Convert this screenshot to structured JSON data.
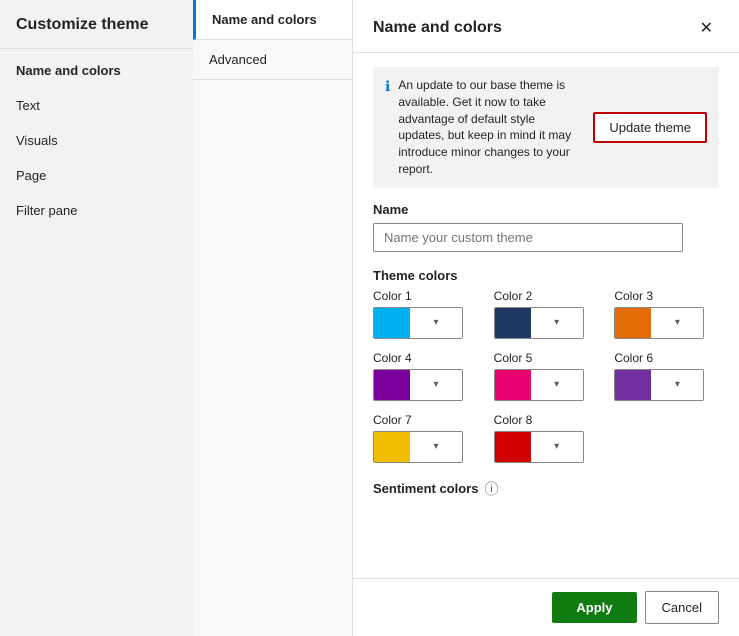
{
  "sidebar": {
    "title": "Customize theme",
    "items": [
      {
        "id": "name-and-colors",
        "label": "Name and colors",
        "active": true
      },
      {
        "id": "text",
        "label": "Text",
        "active": false
      },
      {
        "id": "visuals",
        "label": "Visuals",
        "active": false
      },
      {
        "id": "page",
        "label": "Page",
        "active": false
      },
      {
        "id": "filter-pane",
        "label": "Filter pane",
        "active": false
      }
    ]
  },
  "middle_tabs": [
    {
      "id": "name-and-colors",
      "label": "Name and colors",
      "active": true
    },
    {
      "id": "advanced",
      "label": "Advanced",
      "active": false
    }
  ],
  "main": {
    "title": "Name and colors",
    "close_label": "✕",
    "info_text": "An update to our base theme is available. Get it now to take advantage of default style updates, but keep in mind it may introduce minor changes to your report.",
    "update_theme_label": "Update theme",
    "name_section": {
      "label": "Name",
      "placeholder": "Name your custom theme",
      "value": ""
    },
    "theme_colors_label": "Theme colors",
    "colors": [
      {
        "id": "color1",
        "label": "Color 1",
        "value": "#00B0F0"
      },
      {
        "id": "color2",
        "label": "Color 2",
        "value": "#1F3864"
      },
      {
        "id": "color3",
        "label": "Color 3",
        "value": "#E36C09"
      },
      {
        "id": "color4",
        "label": "Color 4",
        "value": "#7B0099"
      },
      {
        "id": "color5",
        "label": "Color 5",
        "value": "#E8006E"
      },
      {
        "id": "color6",
        "label": "Color 6",
        "value": "#7030A0"
      },
      {
        "id": "color7",
        "label": "Color 7",
        "value": "#F0C000"
      },
      {
        "id": "color8",
        "label": "Color 8",
        "value": "#D00000"
      }
    ],
    "sentiment_colors_label": "Sentiment colors",
    "footer": {
      "apply_label": "Apply",
      "cancel_label": "Cancel"
    }
  }
}
